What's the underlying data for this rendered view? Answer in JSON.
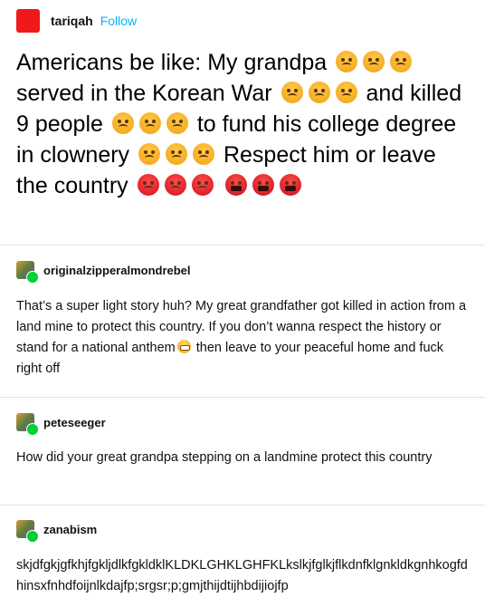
{
  "post": {
    "username": "tariqah",
    "follow_label": "Follow",
    "body": {
      "l1": "Americans be like: My grandpa",
      "l2a": "served in the Korean War",
      "l2b": "and",
      "l3a": "killed 9 people",
      "l3b": "to fund his",
      "l4": "college degree in clownery",
      "l5": "Respect him or leave the country"
    },
    "emoji_names": [
      "angry-face-icon",
      "pouting-face-icon",
      "face-with-symbols-on-mouth-icon"
    ]
  },
  "reblogs": [
    {
      "username": "originalzipperalmondrebel",
      "text_before_emoji": "That’s a super light story huh? My great grandfather got killed in action from a land mine to protect this country. If you don’t wanna respect the history or stand for a national anthem",
      "text_after_emoji": " then leave to your peaceful home and fuck right off"
    },
    {
      "username": "peteseeger",
      "text": "How did your great grandpa stepping on a landmine protect this country"
    },
    {
      "username": "zanabism",
      "text": "skjdfgkjgfkhjfgkljdlkfgkldklKLDKLGHKLGHFKLkslkjfglkjflkdnfklgnkldkgnhkogfdhinsxfnhdfoijnlkdajfp;srgsr;p;gmjthijdtijhbdijiojfp"
    }
  ],
  "colors": {
    "avatar": "#f01919",
    "follow": "#00b8ff",
    "reblog_badge": "#00cf35",
    "divider": "#e4e4e4"
  }
}
